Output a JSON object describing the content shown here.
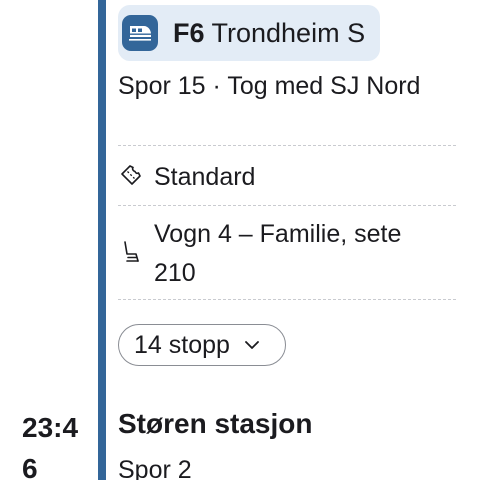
{
  "departure": {
    "line_code": "F6",
    "destination": "Trondheim S",
    "line_icon": "train-icon",
    "track_info": "Spor 15 · Tog med SJ Nord"
  },
  "details": {
    "ticket_class": "Standard",
    "ticket_icon": "ticket-icon",
    "seat": "Vogn 4 – Familie, sete 210",
    "seat_icon": "seat-icon"
  },
  "stops_button": {
    "label": "14 stopp",
    "icon": "chevron-down-icon"
  },
  "next_stop": {
    "time": "23:46",
    "name": "Støren stasjon",
    "track": "Spor 2"
  },
  "colors": {
    "accent": "#336699",
    "chip_background": "#e3ecf6"
  }
}
